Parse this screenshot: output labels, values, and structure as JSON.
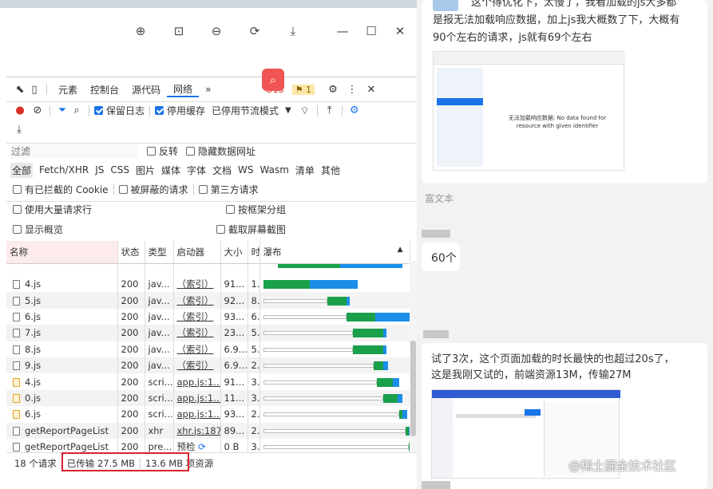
{
  "devtools": {
    "tabs": [
      "元素",
      "控制台",
      "源代码",
      "网络"
    ],
    "more": "»",
    "errors": "13",
    "warnings": "1",
    "preserve_log": "保留日志",
    "disable_cache": "停用缓存",
    "throttle": "已停用节流模式",
    "filter_placeholder": "过滤",
    "invert": "反转",
    "hide_data_urls": "隐藏数据网址",
    "types": [
      "全部",
      "Fetch/XHR",
      "JS",
      "CSS",
      "图片",
      "媒体",
      "字体",
      "文档",
      "WS",
      "Wasm",
      "清单",
      "其他"
    ],
    "blocked_cookies": "有已拦截的 Cookie",
    "blocked_requests": "被屏蔽的请求",
    "third_party": "第三方请求",
    "big_rows": "使用大量请求行",
    "group_by_frame": "按框架分组",
    "overview": "显示概览",
    "screenshots": "截取屏幕截图",
    "columns": [
      "名称",
      "状态",
      "类型",
      "启动器",
      "大小",
      "时",
      "瀑布"
    ],
    "rows": [
      {
        "name": "4.js",
        "status": "200",
        "type": "jav...",
        "initiator": "（索引）",
        "size": "91...",
        "time": "1..."
      },
      {
        "name": "5.js",
        "status": "200",
        "type": "jav...",
        "initiator": "（索引）",
        "size": "92...",
        "time": "8..."
      },
      {
        "name": "6.js",
        "status": "200",
        "type": "jav...",
        "initiator": "（索引）",
        "size": "93...",
        "time": "6..."
      },
      {
        "name": "7.js",
        "status": "200",
        "type": "jav...",
        "initiator": "（索引）",
        "size": "23...",
        "time": "5..."
      },
      {
        "name": "8.js",
        "status": "200",
        "type": "jav...",
        "initiator": "（索引）",
        "size": "6.9...",
        "time": "5..."
      },
      {
        "name": "9.js",
        "status": "200",
        "type": "jav...",
        "initiator": "（索引）",
        "size": "6.9...",
        "time": "2..."
      },
      {
        "name": "4.js",
        "status": "200",
        "type": "scri...",
        "initiator": "app.js:1...",
        "size": "91...",
        "time": "3..."
      },
      {
        "name": "0.js",
        "status": "200",
        "type": "scri...",
        "initiator": "app.js:1...",
        "size": "11...",
        "time": "3..."
      },
      {
        "name": "6.js",
        "status": "200",
        "type": "scri...",
        "initiator": "app.js:1...",
        "size": "93...",
        "time": "2..."
      },
      {
        "name": "getReportPageList",
        "status": "200",
        "type": "xhr",
        "initiator": "xhr.js:187",
        "size": "89...",
        "time": "2..."
      },
      {
        "name": "getReportPageList",
        "status": "200",
        "type": "pre...",
        "initiator": "预检",
        "size": "0 B",
        "time": "3..."
      }
    ],
    "summary_requests": "18 个请求",
    "summary_transferred": "已传输 27.5 MB",
    "summary_resources": "13.6 MB 项资源"
  },
  "chat": {
    "msg1_lines": [
      "这个得优化下，太慢了，我看加载的js大多都",
      "是报无法加载响应数据，加上js我大概数了下，大概有",
      "90个左右的请求，js就有69个左右"
    ],
    "img1_text": "无法加载响应数据: No data found for resource with given identifier",
    "rich_text_label": "富文本",
    "msg2": "60个",
    "msg3_lines": [
      "试了3次，这个页面加载的时长最快的也超过20s了，",
      "这是我刚又试的，前端资源13M，传输27M"
    ],
    "watermark": "@稀土掘金技术社区"
  },
  "colors": {
    "accent": "#1a73e8",
    "waterfall_green": "#1aa04a",
    "waterfall_blue": "#1a8ee8",
    "highlight_red": "#d9232e"
  }
}
